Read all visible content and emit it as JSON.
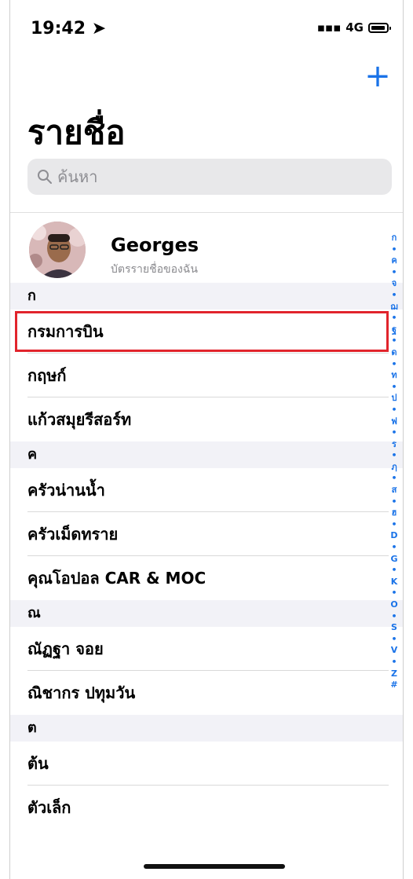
{
  "status": {
    "time": "19:42",
    "network": "4G"
  },
  "header": {
    "add_label": "+",
    "title": "รายชื่อ"
  },
  "search": {
    "placeholder": "ค้นหา"
  },
  "my_card": {
    "name": "Georges",
    "subtitle": "บัตรรายชื่อของฉัน"
  },
  "sections": [
    {
      "letter": "ก",
      "items": [
        "กรมการบิน",
        "กฤษก์",
        "แก้วสมุยรีสอร์ท"
      ]
    },
    {
      "letter": "ค",
      "items": [
        "ครัวน่านน้ำ",
        "ครัวเม็ดทราย",
        "คุณโอปอล CAR & MOC"
      ]
    },
    {
      "letter": "ณ",
      "items": [
        "ณัฏฐา จอย",
        "ณิชากร ปทุมวัน"
      ]
    },
    {
      "letter": "ต",
      "items": [
        "ต้น",
        "ตัวเล็ก"
      ]
    }
  ],
  "index_letters": [
    "ก",
    "•",
    "ค",
    "•",
    "จ",
    "•",
    "ฌ",
    "•",
    "ฐ",
    "•",
    "ด",
    "•",
    "ท",
    "•",
    "ป",
    "•",
    "ฟ",
    "•",
    "ร",
    "•",
    "ฦ",
    "•",
    "ส",
    "•",
    "ฮ",
    "•",
    "D",
    "•",
    "G",
    "•",
    "K",
    "•",
    "O",
    "•",
    "S",
    "•",
    "V",
    "•",
    "Z",
    "#"
  ],
  "colors": {
    "accent": "#1a73e8",
    "highlight": "#e1242c"
  }
}
